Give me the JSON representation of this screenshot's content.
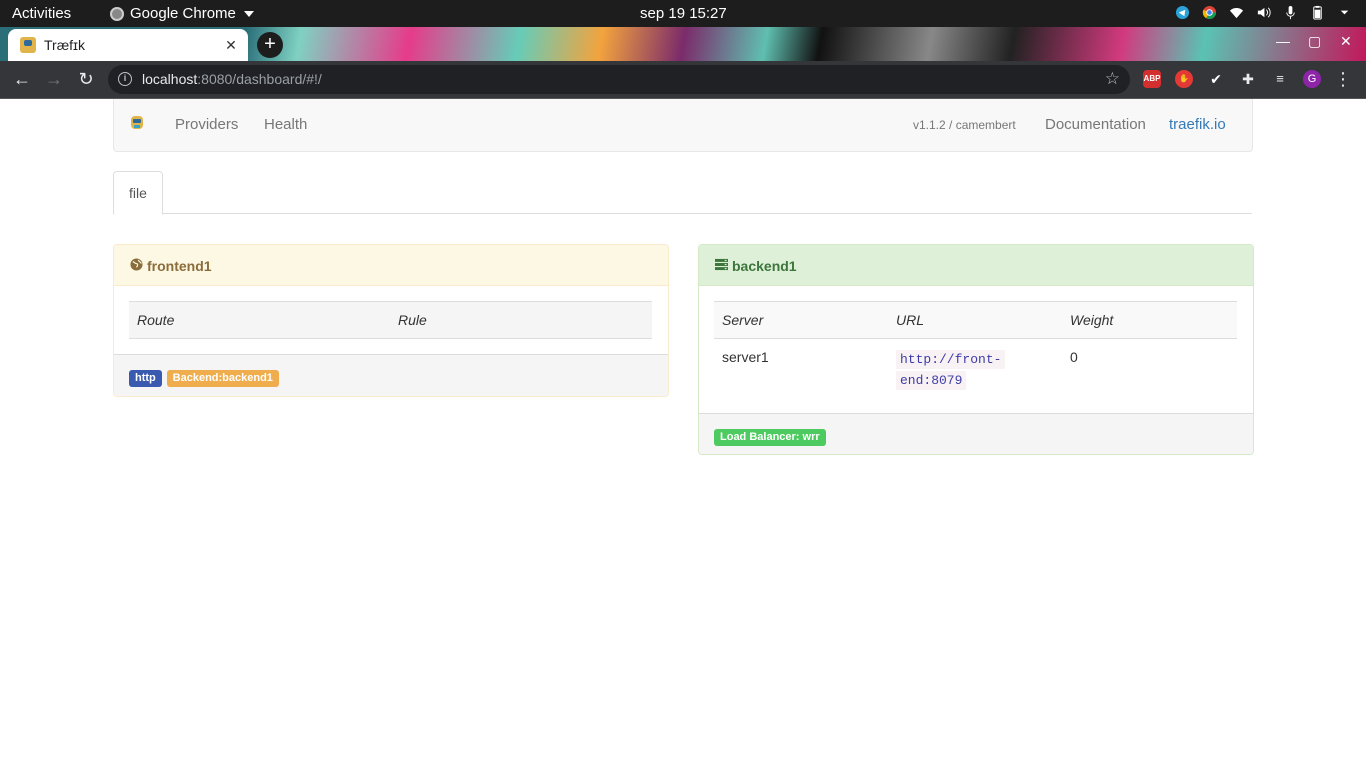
{
  "system_bar": {
    "activities": "Activities",
    "app_name": "Google Chrome",
    "clock": "sep 19  15:27"
  },
  "browser": {
    "tab_title": "Træfɪk",
    "url_host": "localhost",
    "url_rest": ":8080/dashboard/#!/",
    "ext_abp": "ABP",
    "profile_initial": "G"
  },
  "navbar": {
    "providers": "Providers",
    "health": "Health",
    "version": "v1.1.2 / camembert",
    "documentation": "Documentation",
    "traefik_link": "traefik.io"
  },
  "provider_tabs": [
    "file"
  ],
  "frontend": {
    "name": "frontend1",
    "columns": [
      "Route",
      "Rule"
    ],
    "labels": [
      "http",
      "Backend:backend1"
    ]
  },
  "backend": {
    "name": "backend1",
    "columns": [
      "Server",
      "URL",
      "Weight"
    ],
    "rows": [
      {
        "server": "server1",
        "url_line1": "http://front-",
        "url_line2": "end:8079",
        "weight": "0"
      }
    ],
    "load_balancer": "Load Balancer: wrr"
  },
  "colors": {
    "frontend_heading": "#8a6d3b",
    "backend_heading": "#3c763d",
    "link": "#337ab7",
    "label_http": "#3a5ab0",
    "label_backend": "#f0ad4e",
    "label_lb": "#4ecb60"
  }
}
